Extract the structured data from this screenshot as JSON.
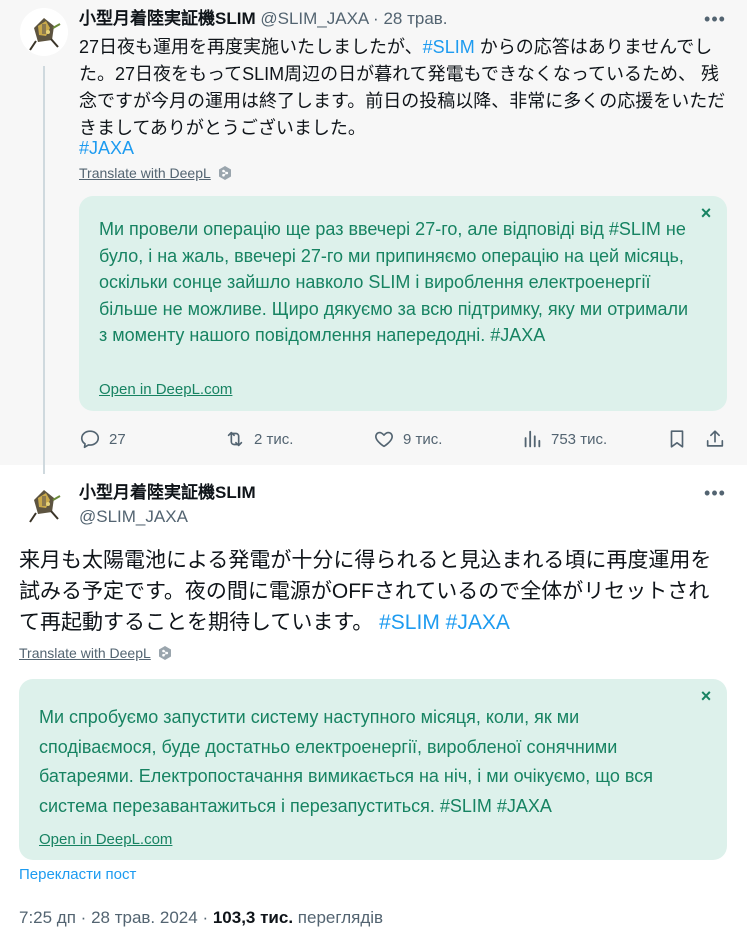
{
  "reply": {
    "author_name": "小型月着陸実証機SLIM",
    "author_handle": "@SLIM_JAXA",
    "separator": "·",
    "date": "28 трав.",
    "text_part1": "27日夜も運用を再度実施いたしましたが、",
    "text_hashtag_slim": "#SLIM",
    "text_part2": " からの応答はありませんでした。27日夜をもってSLIM周辺の日が暮れて発電もできなくなっているため、 残念ですが今月の運用は終了します。前日の投稿以降、非常に多くの応援をいただきましてありがとうございました。",
    "hashtag_jaxa": "#JAXA",
    "translate_link": "Translate with DeepL",
    "deepl": {
      "close_icon": "×",
      "translation": "Ми провели операцію ще раз ввечері 27-го, але відповіді від #SLIM не було, і на жаль, ввечері 27-го ми припиняємо операцію на цей місяць, оскільки сонце зайшло навколо SLIM і вироблення електроенергії більше не можливе. Щиро дякуємо за всю підтримку, яку ми отримали з моменту нашого повідомлення напередодні. #JAXA",
      "open_link": "Open in DeepL.com"
    },
    "actions": {
      "replies": "27",
      "reposts": "2 тис.",
      "likes": "9 тис.",
      "views": "753 тис."
    }
  },
  "main": {
    "author_name": "小型月着陸実証機SLIM",
    "author_handle": "@SLIM_JAXA",
    "text": "来月も太陽電池による発電が十分に得られると見込まれる頃に再度運用を試みる予定です。夜の間に電源がOFFされているので全体がリセットされて再起動することを期待しています。",
    "hashtags": "#SLIM #JAXA",
    "translate_link": "Translate with DeepL",
    "deepl": {
      "close_icon": "×",
      "translation": "Ми спробуємо запустити систему наступного місяця, коли, як ми сподіваємося, буде достатньо електроенергії, виробленої сонячними батареями. Електропостачання вимикається на ніч, і ми очікуємо, що вся система перезавантажиться і перезапуститься. #SLIM #JAXA",
      "open_link": "Open in DeepL.com"
    },
    "translate_post": "Перекласти пост",
    "time": "7:25 дп",
    "separator": "·",
    "date": "28 трав. 2024",
    "views_count": "103,3 тис.",
    "views_label": "переглядів"
  },
  "colors": {
    "hashtag": "#1d9bf0",
    "deepl_bg": "#ddf1eb",
    "deepl_text": "#178362",
    "muted": "#536471",
    "reply_bg": "#f7f7f7"
  },
  "icons": [
    "more-icon",
    "deepl-logo-icon",
    "close-icon",
    "reply-icon",
    "repost-icon",
    "like-icon",
    "views-icon",
    "bookmark-icon",
    "share-icon"
  ]
}
